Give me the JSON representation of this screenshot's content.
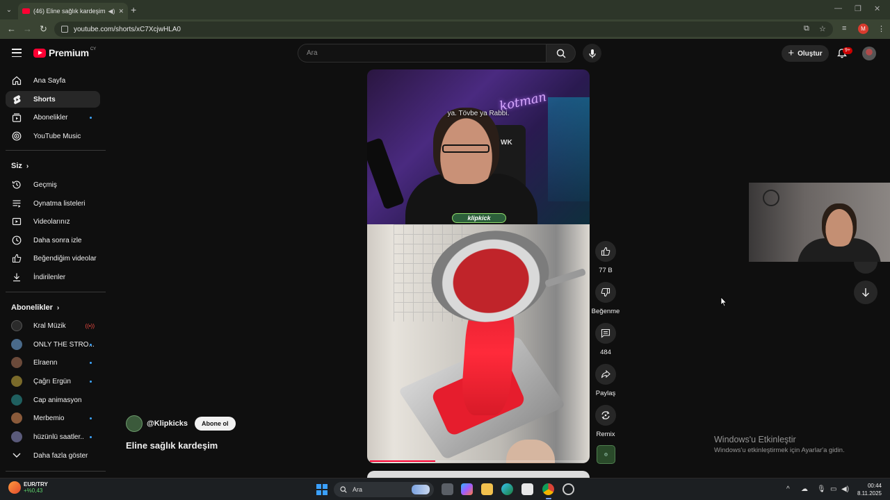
{
  "browser": {
    "tab_title": "(46) Eline sağlık kardeşim -",
    "url": "youtube.com/shorts/xC7XcjwHLA0",
    "profile_initial": "M"
  },
  "header": {
    "logo_text": "Premium",
    "logo_region": "CY",
    "search_placeholder": "Ara",
    "create_label": "Oluştur",
    "notification_count": "9+"
  },
  "sidebar": {
    "main": [
      {
        "label": "Ana Sayfa",
        "icon": "home-icon"
      },
      {
        "label": "Shorts",
        "icon": "shorts-icon",
        "active": true
      },
      {
        "label": "Abonelikler",
        "icon": "subscriptions-icon"
      },
      {
        "label": "YouTube Music",
        "icon": "music-icon"
      }
    ],
    "you_header": "Siz",
    "you": [
      {
        "label": "Geçmiş",
        "icon": "history-icon"
      },
      {
        "label": "Oynatma listeleri",
        "icon": "playlist-icon"
      },
      {
        "label": "Videolarınız",
        "icon": "your-videos-icon"
      },
      {
        "label": "Daha sonra izle",
        "icon": "watch-later-icon"
      },
      {
        "label": "Beğendiğim videolar",
        "icon": "liked-icon"
      },
      {
        "label": "İndirilenler",
        "icon": "download-icon"
      }
    ],
    "subs_header": "Abonelikler",
    "subscriptions": [
      {
        "label": "Kral Müzik",
        "live": "((•))",
        "color": "#2b2b2b"
      },
      {
        "label": "ONLY THE STRO...",
        "color": "#4a6a8a"
      },
      {
        "label": "Elraenn",
        "color": "#6b4a3a"
      },
      {
        "label": "Çağrı Ergün",
        "color": "#7a6a2a"
      },
      {
        "label": "Cap animasyon",
        "color": "#1f5f5f"
      },
      {
        "label": "Merbemio",
        "color": "#8a5a3a"
      },
      {
        "label": "hüzünlü saatler..",
        "color": "#5a5a7a"
      }
    ],
    "show_more": "Daha fazla göster"
  },
  "video": {
    "caption": "ya. Tövbe ya Rabbi.",
    "neon_sign": "kotman",
    "overlay_badge": "klipkick",
    "chair_text": "WK",
    "progress_fraction": 0.3
  },
  "actions": {
    "like_count": "77 B",
    "dislike_label": "Beğenme",
    "comment_count": "484",
    "share_label": "Paylaş",
    "remix_label": "Remix"
  },
  "channel": {
    "handle": "@Klipkicks",
    "subscribe_label": "Abone ol",
    "title": "Eline sağlık kardeşim"
  },
  "activation": {
    "title": "Windows'u Etkinleştir",
    "subtitle": "Windows'u etkinleştirmek için Ayarlar'a gidin."
  },
  "taskbar": {
    "stock_name": "EUR/TRY",
    "stock_change": "+%0,43",
    "search_label": "Ara",
    "time": "00:44",
    "date": "8.11.2025"
  }
}
